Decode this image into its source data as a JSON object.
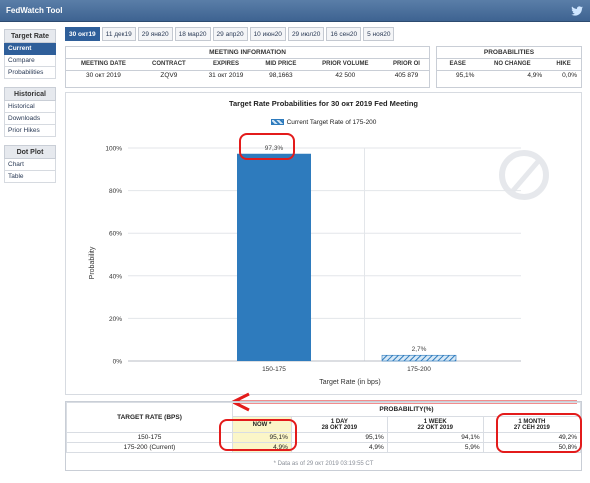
{
  "app": {
    "title": "FedWatch Tool"
  },
  "sidebar": {
    "sections": [
      {
        "header": "Target Rate",
        "items": [
          "Current",
          "Compare",
          "Probabilities"
        ],
        "active": 0
      },
      {
        "header": "Historical",
        "items": [
          "Historical",
          "Downloads",
          "Prior Hikes"
        ],
        "active": -1
      },
      {
        "header": "Dot Plot",
        "items": [
          "Chart",
          "Table"
        ],
        "active": -1
      }
    ]
  },
  "tabs": [
    "30 окт19",
    "11 дек19",
    "29 янв20",
    "18 мар20",
    "29 апр20",
    "10 июн20",
    "29 июл20",
    "16 сен20",
    "5 ноя20"
  ],
  "meeting_info": {
    "header": "MEETING INFORMATION",
    "columns": [
      "MEETING DATE",
      "CONTRACT",
      "EXPIRES",
      "MID PRICE",
      "PRIOR VOLUME",
      "PRIOR OI"
    ],
    "row": [
      "30 окт 2019",
      "ZQV9",
      "31 окт 2019",
      "98,1663",
      "42 500",
      "405 879"
    ]
  },
  "probabilities": {
    "header": "PROBABILITIES",
    "columns": [
      "EASE",
      "NO CHANGE",
      "HIKE"
    ],
    "row": [
      "95,1%",
      "4,9%",
      "0,0%"
    ]
  },
  "chart_data": {
    "type": "bar",
    "title": "Target Rate Probabilities for 30 окт 2019 Fed Meeting",
    "legend": "Current Target Rate of 175-200",
    "categories": [
      "150-175",
      "175-200"
    ],
    "values": [
      97.3,
      2.7
    ],
    "value_labels": [
      "97,3%",
      "2,7%"
    ],
    "xlabel": "Target Rate (in bps)",
    "ylabel": "Probability",
    "ylim": [
      0,
      100
    ],
    "yticks": [
      "0%",
      "20%",
      "40%",
      "60%",
      "80%",
      "100%"
    ],
    "colors": {
      "solid": "#2e7bbd",
      "hatched": "#2e7bbd"
    }
  },
  "prob_table": {
    "left_header": "TARGET RATE (BPS)",
    "top_header": "PROBABILITY(%)",
    "columns": [
      {
        "title": "NOW *",
        "date": ""
      },
      {
        "title": "1 DAY",
        "date": "28 ОКТ 2019"
      },
      {
        "title": "1 WEEK",
        "date": "22 ОКТ 2019"
      },
      {
        "title": "1 MONTH",
        "date": "27 СЕН 2019"
      }
    ],
    "rows": [
      {
        "rate": "150-175",
        "values": [
          "95,1%",
          "95,1%",
          "94,1%",
          "49,2%"
        ]
      },
      {
        "rate": "175-200 (Current)",
        "values": [
          "4,9%",
          "4,9%",
          "5,9%",
          "50,8%"
        ]
      }
    ],
    "footnote": "* Data as of 29 окт 2019 03:19:55 CT"
  }
}
